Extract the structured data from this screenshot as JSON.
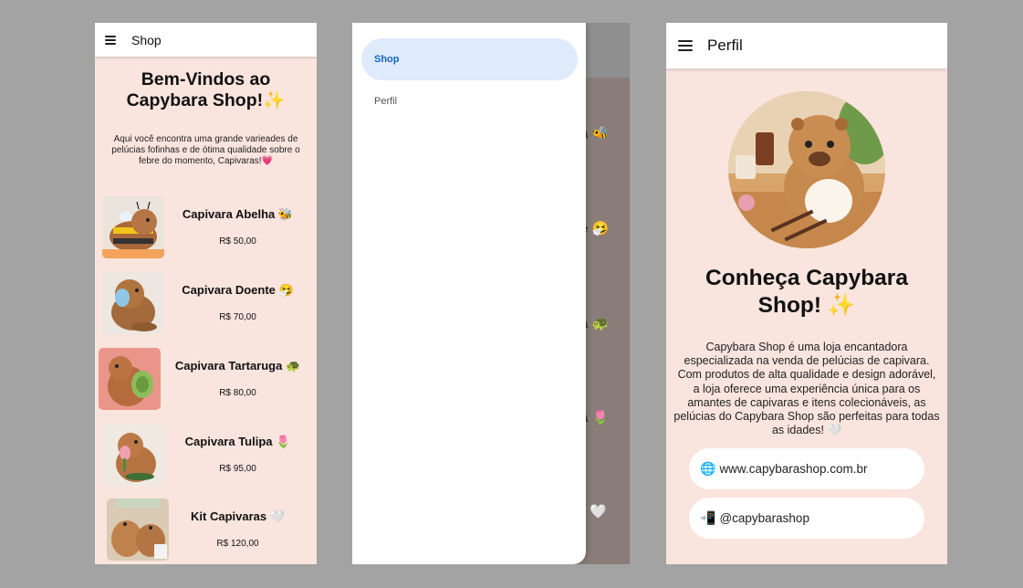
{
  "shop": {
    "title": "Shop",
    "welcome_line1": "Bem-Vindos ao",
    "welcome_line2": "Capybara Shop!✨",
    "intro": "Aqui você encontra uma grande varieades de pelúcias fofinhas e de ótima qualidade sobre o febre do momento, Capivaras!💗",
    "products": [
      {
        "name": "Capivara Abelha 🐝",
        "price": "R$ 50,00"
      },
      {
        "name": "Capivara Doente 🤧",
        "price": "R$ 70,00"
      },
      {
        "name": "Capivara Tartaruga 🐢",
        "price": "R$ 80,00"
      },
      {
        "name": "Capivara Tulipa 🌷",
        "price": "R$ 95,00"
      },
      {
        "name": "Kit Capivaras 🤍",
        "price": "R$ 120,00"
      }
    ]
  },
  "drawer": {
    "items": [
      {
        "label": "Shop",
        "active": true
      },
      {
        "label": "Perfil",
        "active": false
      }
    ],
    "background_fragments": [
      "a 🐝",
      "e 🤧",
      "a 🐢",
      "a 🌷",
      "🤍"
    ]
  },
  "perfil": {
    "title": "Perfil",
    "about_line1": "Conheça Capybara",
    "about_line2": "Shop! ✨",
    "about_text": "Capybara Shop é uma loja encantadora especializada na venda de pelúcias de capivara. Com produtos de alta qualidade e design adorável, a loja oferece uma experiência única para os amantes de capivaras e itens colecionáveis, as pelúcias do Capybara Shop são perfeitas para todas as idades! 🤍",
    "website": {
      "icon": "🌐",
      "text": "www.capybarashop.com.br"
    },
    "social": {
      "icon": "📲",
      "text": "@capybarashop"
    }
  },
  "colors": {
    "page_background": "#a3a3a3",
    "screen_background": "#f9e4de",
    "drawer_active_bg": "#dfeafb",
    "drawer_active_text": "#1565c0"
  }
}
